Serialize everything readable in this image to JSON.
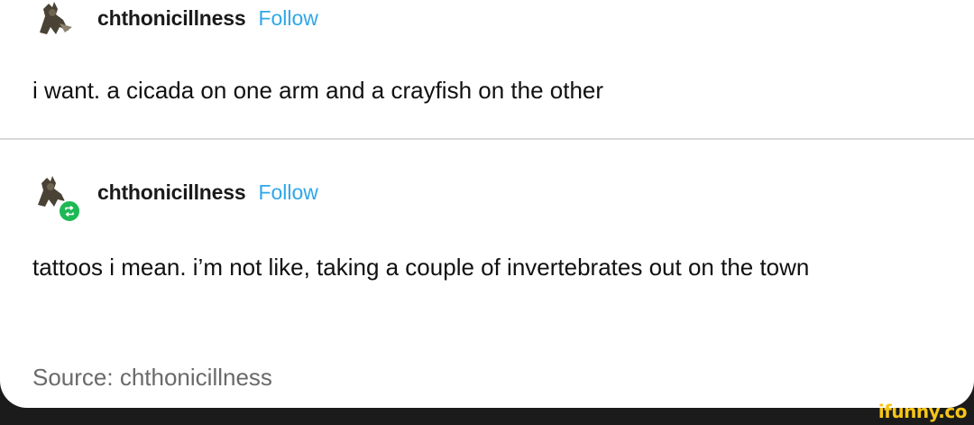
{
  "posts": [
    {
      "username": "chthonicillness",
      "follow_label": "Follow",
      "text": "i want. a cicada on one arm and a crayfish on the other"
    },
    {
      "username": "chthonicillness",
      "follow_label": "Follow",
      "text": "tattoos i mean. i’m not like, taking a couple of invertebrates out on the town"
    }
  ],
  "source_label": "Source: chthonicillness",
  "watermark": "ifunny.co",
  "colors": {
    "follow": "#2fa7e8",
    "reblog_badge": "#1db954",
    "watermark": "#f5c518"
  },
  "icons": {
    "avatar": "creature-avatar-icon",
    "reblog": "reblog-icon"
  }
}
